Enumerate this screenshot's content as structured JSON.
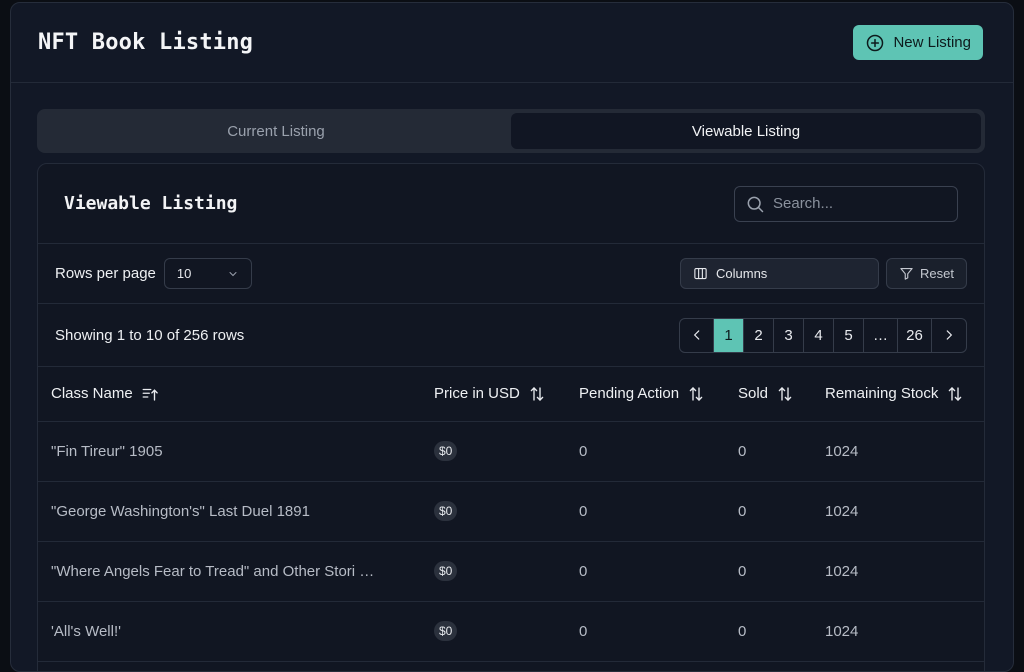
{
  "header": {
    "title": "NFT Book Listing",
    "new_listing_label": "New Listing",
    "new_listing_icon": "plus-circle-icon"
  },
  "tabs": [
    {
      "label": "Current Listing",
      "active": false
    },
    {
      "label": "Viewable Listing",
      "active": true
    }
  ],
  "card": {
    "title": "Viewable Listing",
    "search": {
      "placeholder": "Search...",
      "value": ""
    }
  },
  "toolbar": {
    "rows_per_page_label": "Rows per page",
    "rows_per_page_value": "10",
    "columns_label": "Columns",
    "reset_label": "Reset"
  },
  "pagination": {
    "showing_text": "Showing 1 to 10 of 256 rows",
    "pages": [
      "1",
      "2",
      "3",
      "4",
      "5",
      "…",
      "26"
    ],
    "current_page": "1"
  },
  "table": {
    "columns": [
      "Class Name",
      "Price in USD",
      "Pending Action",
      "Sold",
      "Remaining Stock"
    ],
    "rows": [
      {
        "class_name": "\"Fin Tireur\" 1905",
        "price": "$0",
        "pending": "0",
        "sold": "0",
        "stock": "1024"
      },
      {
        "class_name": "\"George Washington's\" Last Duel 1891",
        "price": "$0",
        "pending": "0",
        "sold": "0",
        "stock": "1024"
      },
      {
        "class_name": "\"Where Angels Fear to Tread\" and Other Stories of the Sea",
        "price": "$0",
        "pending": "0",
        "sold": "0",
        "stock": "1024"
      },
      {
        "class_name": "'All's Well!'",
        "price": "$0",
        "pending": "0",
        "sold": "0",
        "stock": "1024"
      }
    ]
  },
  "colors": {
    "accent": "#5ec4b4",
    "background": "#121826",
    "border": "#232a38"
  }
}
